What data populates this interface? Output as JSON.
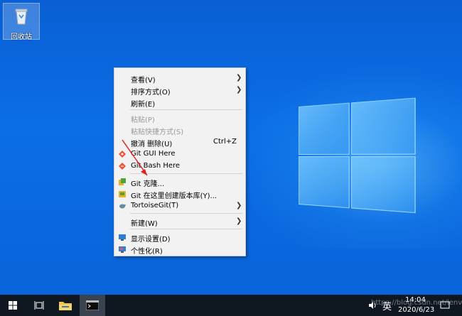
{
  "desktop": {
    "recycle_bin_label": "回收站"
  },
  "context_menu": {
    "items": [
      {
        "label": "查看(V)",
        "submenu": true
      },
      {
        "label": "排序方式(O)",
        "submenu": true
      },
      {
        "label": "刷新(E)"
      },
      {
        "label": "粘贴(P)",
        "disabled": true
      },
      {
        "label": "粘贴快捷方式(S)",
        "disabled": true
      },
      {
        "label": "撤消 删除(U)",
        "shortcut": "Ctrl+Z"
      },
      {
        "label": "Git GUI Here",
        "icon": "git-gui-icon"
      },
      {
        "label": "Git Bash Here",
        "icon": "git-bash-icon"
      },
      {
        "label": "Git 克隆...",
        "icon": "tortoisegit-clone-icon"
      },
      {
        "label": "Git 在这里创建版本库(Y)...",
        "icon": "tortoisegit-create-repo-icon"
      },
      {
        "label": "TortoiseGit(T)",
        "icon": "tortoisegit-icon",
        "submenu": true
      },
      {
        "label": "新建(W)",
        "submenu": true
      },
      {
        "label": "显示设置(D)",
        "icon": "display-settings-icon"
      },
      {
        "label": "个性化(R)",
        "icon": "personalize-icon"
      }
    ]
  },
  "taskbar": {
    "time": "14:04",
    "date": "2020/6/23",
    "ime": "英",
    "icons": [
      "windows-start-icon",
      "task-view-icon",
      "file-explorer-icon",
      "terminal-icon"
    ]
  },
  "watermark": "https://blog.csdn.net/lenvsky"
}
